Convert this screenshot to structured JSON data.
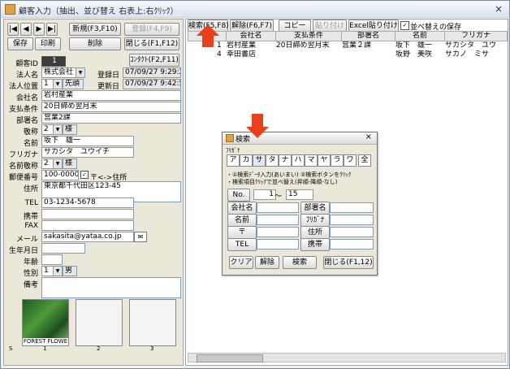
{
  "window": {
    "title": "顧客入力（抽出、並び替え 右表上:右ｸﾘｯｸ）",
    "close_glyph": "×"
  },
  "nav": {
    "first": "|◀",
    "prev": "◀",
    "next": "▶",
    "last": "▶|",
    "new": "新規(F3,F10)",
    "register": "登録(F4,F9)",
    "save": "保存",
    "print": "印刷",
    "delete": "削除",
    "close": "閉じる(F1,F12)",
    "contact": "ｺﾝﾀｸﾄ(F2,F11)"
  },
  "form": {
    "customer_id_label": "顧客ID",
    "customer_id": "1",
    "corp_label": "法人名",
    "corp_value": "株式会社",
    "reg_label": "登録日",
    "reg_value": "07/09/27 9:29:28",
    "corp_pos_label": "法人位置",
    "corp_pos_value": "1",
    "corp_pos_badge": "先頭",
    "upd_label": "更新日",
    "upd_value": "07/09/27 9:42:59",
    "company_label": "会社名",
    "company_value": "岩村産業",
    "pay_label": "支払条件",
    "pay_value": "20日締め翌月末",
    "dept_label": "部署名",
    "dept_value": "営業2課",
    "honor_label": "敬称",
    "honor_num": "2",
    "honor_value": "様",
    "name_label": "名前",
    "name_value": "坂下　雄一",
    "kana_label": "フリガナ",
    "kana_value": "サカシタ　ユウイチ",
    "name_honor_label": "名前敬称",
    "name_honor_num": "2",
    "name_honor_value": "様",
    "zip_label": "郵便番号",
    "zip_value": "100-0000",
    "addr_toggle": "〒<->住所",
    "addr_label": "住所",
    "addr_value": "東京都千代田区123-45",
    "tel_label": "TEL",
    "tel_value": "03-1234-5678",
    "mobile_label": "携帯",
    "mobile_value": "",
    "fax_label": "FAX",
    "fax_value": "",
    "mail_label": "メール",
    "mail_value": "sakasita@yataa.co.jp",
    "birth_label": "生年月日",
    "birth_value": "",
    "age_label": "年齢",
    "age_value": "",
    "sex_label": "性別",
    "sex_num": "1",
    "sex_value": "男",
    "note_label": "備考",
    "note_value": ""
  },
  "photos": [
    {
      "caption": "FOREST FLOWE",
      "num": "1"
    },
    {
      "caption": "",
      "num": "2"
    },
    {
      "caption": "",
      "num": "3"
    }
  ],
  "photo_s": "S",
  "toolbar": {
    "search": "検索(F5,F8)",
    "clear": "解除(F6,F7)",
    "copy": "コピー",
    "paste": "貼り付け",
    "excel": "Excel貼り付け",
    "save_sort": "並べ替えの保存"
  },
  "grid": {
    "headers": [
      "ID",
      "会社名",
      "支払条件",
      "部署名",
      "名前",
      "フリガナ"
    ],
    "rows": [
      [
        "1",
        "岩村産業",
        "20日締め翌月末",
        "営業２課",
        "坂下　雄一",
        "サカシタ　ユウ"
      ],
      [
        "4",
        "幸田書店",
        "",
        "",
        "坂野　美咲",
        "サカノ　ミサ"
      ]
    ]
  },
  "dialog": {
    "title": "検索",
    "furigana": "ﾌﾘｶﾞﾅ",
    "kana": [
      "ア",
      "カ",
      "サ",
      "タ",
      "ナ",
      "ハ",
      "マ",
      "ヤ",
      "ラ",
      "ワ",
      "全"
    ],
    "note1": "・①検索ﾃﾞｰﾀ入力(あいまい) ②検索ボタンをｸﾘｯｸ",
    "note2": "・検索項目ｸﾘｯｸで並べ替え(昇順-降順-なし)",
    "no_label": "No.",
    "no_from": "1",
    "tilde": "～",
    "no_to": "15",
    "company": "会社名",
    "dept": "部署名",
    "name": "名前",
    "kana_field": "ﾌﾘｶﾞﾅ",
    "zip": "〒",
    "addr": "住所",
    "tel": "TEL",
    "mobile": "携帯",
    "btn_clear": "クリア",
    "btn_release": "解除",
    "btn_search": "検索",
    "btn_close": "閉じる(F1,12)"
  },
  "colors": {
    "arrow": "#e8401c",
    "accent": "#316ac5"
  }
}
